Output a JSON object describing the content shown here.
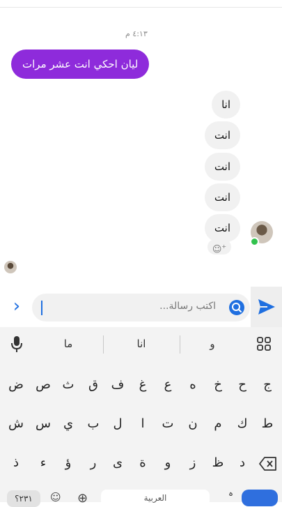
{
  "chat": {
    "timestamp": "٤:١٣ م",
    "sent_message": "ليان احكي انت عشر مرات",
    "received_messages": [
      "انا",
      "انت",
      "انت",
      "انت",
      "انت"
    ]
  },
  "composer": {
    "placeholder": "اكتب رسالة...",
    "send_color": "#1f6fe0"
  },
  "keyboard": {
    "suggestions": [
      "و",
      "انا",
      "ما"
    ],
    "row1": [
      "ج",
      "ح",
      "خ",
      "ه",
      "ع",
      "غ",
      "ف",
      "ق",
      "ث",
      "ص",
      "ض"
    ],
    "row2": [
      "ط",
      "ك",
      "م",
      "ن",
      "ت",
      "ا",
      "ل",
      "ب",
      "ي",
      "س",
      "ش"
    ],
    "row3": [
      "د",
      "ظ",
      "ز",
      "و",
      "ة",
      "ى",
      "ر",
      "ؤ",
      "ء",
      "ذ"
    ],
    "num_key": "٢٣١؟",
    "space_label": "العربية",
    "emoji_key": "☺",
    "globe_key": "⊕",
    "period_key": "ہ"
  }
}
